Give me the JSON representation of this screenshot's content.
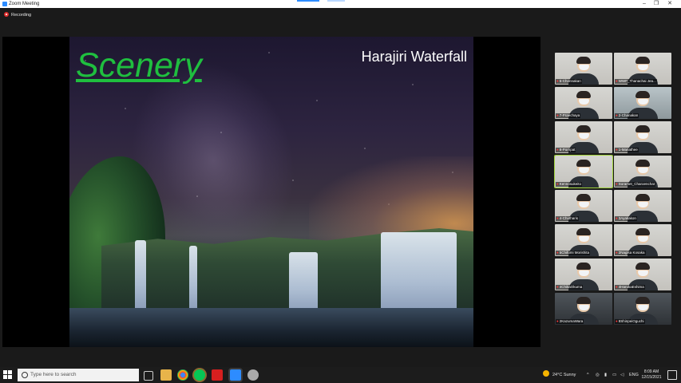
{
  "window": {
    "title": "Zoom Meeting",
    "minimize": "–",
    "restore": "❐",
    "close": "✕"
  },
  "recording": {
    "label": "Recording"
  },
  "slide": {
    "title": "Scenery",
    "caption": "Harajiri Waterfall"
  },
  "participants": [
    {
      "name": "5-Chonnakan",
      "active": false
    },
    {
      "name": "WWF_Thanachai Jea...",
      "active": false
    },
    {
      "name": "7-Praechaya",
      "active": false
    },
    {
      "name": "2-Chanakan",
      "active": false
    },
    {
      "name": "8-Pornpat",
      "active": false
    },
    {
      "name": "1-Manathee",
      "active": false
    },
    {
      "name": "Kennosukeito",
      "active": true
    },
    {
      "name": "Soramet_Charoenchat",
      "active": false
    },
    {
      "name": "4-Chutharis",
      "active": false
    },
    {
      "name": "3Ayakakon",
      "active": false
    },
    {
      "name": "5Chifumi Morishita",
      "active": false
    },
    {
      "name": "2Nagisa Kosaka",
      "active": false
    },
    {
      "name": "4ChikaOkuma",
      "active": false
    },
    {
      "name": "4HarukaEshima",
      "active": false
    },
    {
      "name": "2KazumaWara",
      "active": false
    },
    {
      "name": "8ShinpeiOguchi",
      "active": false
    }
  ],
  "taskbar": {
    "search_placeholder": "Type here to search",
    "weather": "24°C  Sunny",
    "language": "ENG",
    "time": "8:09 AM",
    "date": "12/15/2021"
  },
  "colors": {
    "accent": "#2d8cff",
    "slide_title": "#1fbf3f",
    "active_speaker": "#9fd13a",
    "recording_dot": "#e02f2f"
  }
}
